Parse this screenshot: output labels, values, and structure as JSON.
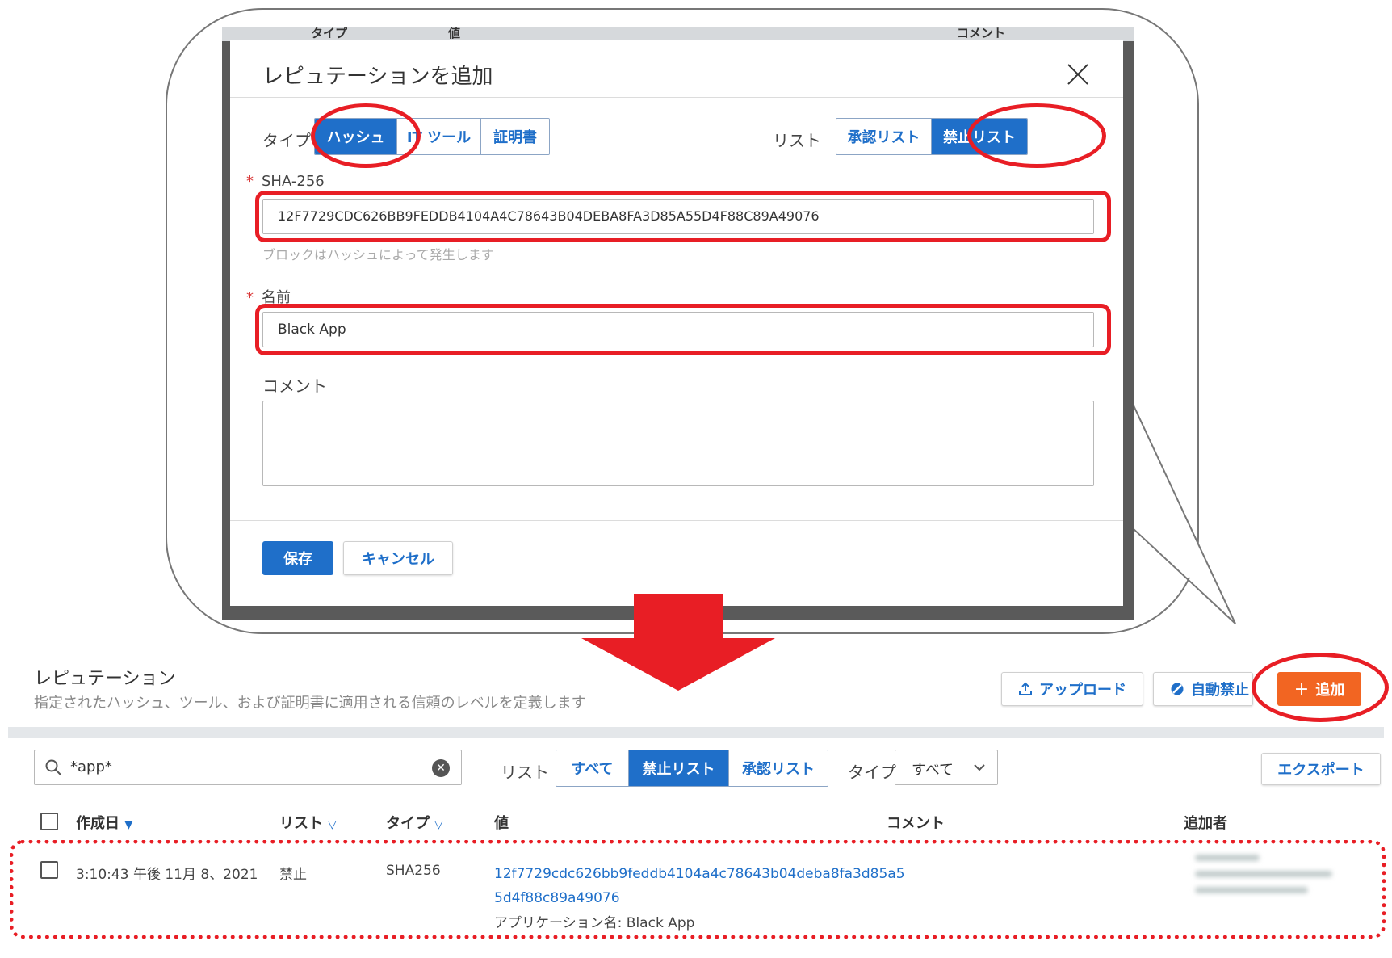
{
  "dialog": {
    "title": "レピュテーションを追加",
    "type_label": "タイプ",
    "type_options": [
      "ハッシュ",
      "IT ツール",
      "証明書"
    ],
    "list_label": "リスト",
    "list_options": [
      "承認リスト",
      "禁止リスト"
    ],
    "sha_label": "SHA-256",
    "sha_value": "12F7729CDC626BB9FEDDB4104A4C78643B04DEBA8FA3D85A55D4F88C89A49076",
    "sha_hint": "ブロックはハッシュによって発生します",
    "name_label": "名前",
    "name_value": "Black App",
    "comment_label": "コメント",
    "comment_value": "",
    "save_label": "保存",
    "cancel_label": "キャンセル",
    "required_mark": "*",
    "backdrop_headers": [
      "タイプ",
      "値",
      "コメント"
    ]
  },
  "page": {
    "title": "レピュテーション",
    "subtitle": "指定されたハッシュ、ツール、および証明書に適用される信頼のレベルを定義します",
    "upload_label": "アップロード",
    "auto_ban_label": "自動禁止",
    "add_label": "追加",
    "search_value": "*app*",
    "list_label": "リスト",
    "list_filters": [
      "すべて",
      "禁止リスト",
      "承認リスト"
    ],
    "type_label": "タイプ",
    "type_select": "すべて",
    "export_label": "エクスポート"
  },
  "table": {
    "headers": {
      "created": "作成日",
      "list": "リスト",
      "type": "タイプ",
      "value": "値",
      "comment": "コメント",
      "added_by": "追加者"
    },
    "row": {
      "created": "3:10:43 午後 11月 8、2021",
      "list": "禁止",
      "type": "SHA256",
      "value_line1": "12f7729cdc626bb9feddb4104a4c78643b04deba8fa3d85a5",
      "value_line2": "5d4f88c89a49076",
      "app_name": "アプリケーション名: Black App"
    }
  },
  "colors": {
    "accent": "#1f6fc9",
    "highlight": "#e81e25",
    "add_button": "#f26522"
  },
  "icons": [
    "close-icon",
    "upload-icon",
    "ban-icon",
    "plus-icon",
    "search-icon",
    "clear-icon",
    "chevron-down-icon",
    "sort-down-icon",
    "red-arrow-down"
  ]
}
